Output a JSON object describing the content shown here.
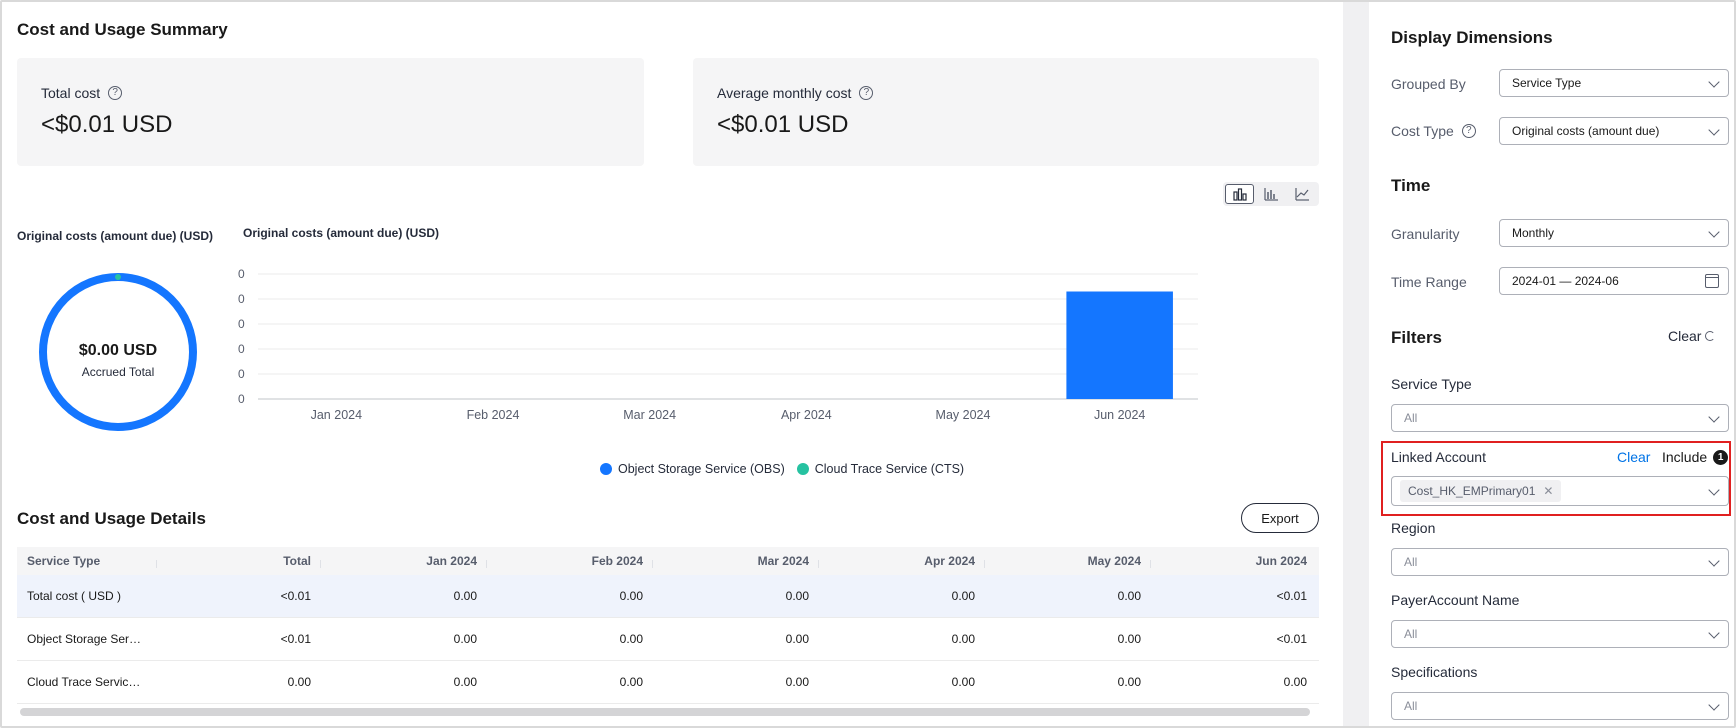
{
  "summary": {
    "title": "Cost and Usage Summary",
    "total_cost_label": "Total cost",
    "total_cost_value": "<$0.01 USD",
    "avg_cost_label": "Average monthly cost",
    "avg_cost_value": "<$0.01 USD"
  },
  "chart_switch": {
    "icons": [
      "bar-chart-icon",
      "stacked-bar-icon",
      "line-chart-icon"
    ],
    "active": 0
  },
  "donut": {
    "caption": "Original costs (amount due) (USD)",
    "value": "$0.00 USD",
    "sub": "Accrued Total"
  },
  "chart_data": [
    {
      "type": "pie",
      "title": "Original costs (amount due) (USD)",
      "labels": [
        "Object Storage Service (OBS)",
        "Cloud Trace Service (CTS)"
      ],
      "values": [
        99,
        1
      ],
      "colors": [
        "#1476ff",
        "#26c2a1"
      ],
      "center_text": "$0.00 USD",
      "center_subtext": "Accrued Total"
    },
    {
      "type": "bar",
      "title": "Original costs (amount due) (USD)",
      "categories": [
        "Jan 2024",
        "Feb 2024",
        "Mar 2024",
        "Apr 2024",
        "May 2024",
        "Jun 2024"
      ],
      "y_tick_labels": [
        "0",
        "0",
        "0",
        "0",
        "0",
        "0"
      ],
      "ylim": [
        0,
        5
      ],
      "grid": true,
      "series": [
        {
          "name": "Object Storage Service (OBS)",
          "color": "#1476ff",
          "values": [
            0,
            0,
            0,
            0,
            0,
            4.3
          ]
        },
        {
          "name": "Cloud Trace Service (CTS)",
          "color": "#26c2a1",
          "values": [
            0,
            0,
            0,
            0,
            0,
            0
          ]
        }
      ],
      "legend": "bottom"
    }
  ],
  "details": {
    "title": "Cost and Usage Details",
    "export_label": "Export",
    "columns": [
      "Service Type",
      "Total",
      "Jan 2024",
      "Feb 2024",
      "Mar 2024",
      "Apr 2024",
      "May 2024",
      "Jun 2024"
    ],
    "rows": [
      [
        "Total cost ( USD )",
        "<0.01",
        "0.00",
        "0.00",
        "0.00",
        "0.00",
        "0.00",
        "<0.01"
      ],
      [
        "Object Storage Ser…",
        "<0.01",
        "0.00",
        "0.00",
        "0.00",
        "0.00",
        "0.00",
        "<0.01"
      ],
      [
        "Cloud Trace Servic…",
        "0.00",
        "0.00",
        "0.00",
        "0.00",
        "0.00",
        "0.00",
        "0.00"
      ]
    ]
  },
  "panel": {
    "display_title": "Display Dimensions",
    "grouped_by_label": "Grouped By",
    "grouped_by_value": "Service Type",
    "cost_type_label": "Cost Type",
    "cost_type_value": "Original costs (amount due)",
    "time_title": "Time",
    "granularity_label": "Granularity",
    "granularity_value": "Monthly",
    "time_range_label": "Time Range",
    "time_range_value": "2024-01 — 2024-06",
    "filters_title": "Filters",
    "clear_label": "Clear",
    "service_type_label": "Service Type",
    "service_type_value": "All",
    "linked_account_label": "Linked Account",
    "linked_clear": "Clear",
    "linked_include": "Include",
    "linked_count": "1",
    "linked_tag": "Cost_HK_EMPrimary01",
    "region_label": "Region",
    "region_value": "All",
    "payer_label": "PayerAccount Name",
    "payer_value": "All",
    "spec_label": "Specifications",
    "spec_value": "All"
  }
}
